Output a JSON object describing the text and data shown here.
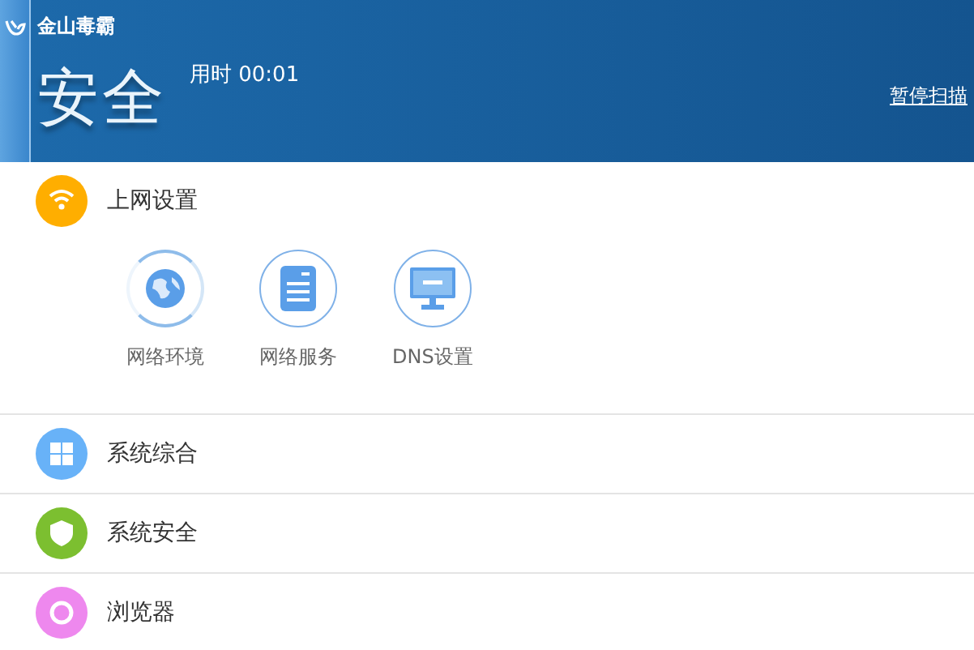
{
  "header": {
    "app_name": "金山毒霸",
    "status": "安全",
    "elapsed": "用时 00:01",
    "pause_link": "暂停扫描"
  },
  "categories": [
    {
      "label": "上网设置",
      "kind": "wifi",
      "color": "#ffae00",
      "children": [
        {
          "label": "网络环境",
          "kind": "globe",
          "active": true
        },
        {
          "label": "网络服务",
          "kind": "server",
          "active": false
        },
        {
          "label": "DNS设置",
          "kind": "monitor",
          "active": false
        }
      ]
    },
    {
      "label": "系统综合",
      "kind": "windows",
      "color": "#68b2f8"
    },
    {
      "label": "系统安全",
      "kind": "shield",
      "color": "#7cbf30"
    },
    {
      "label": "浏览器",
      "kind": "browser",
      "color": "#ee88ee"
    }
  ]
}
